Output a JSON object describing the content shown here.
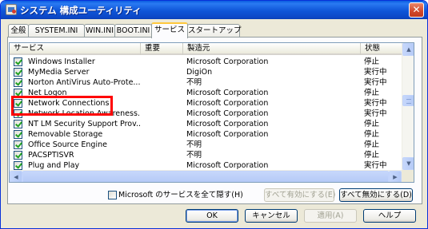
{
  "window": {
    "title": "システム 構成ユーティリティ",
    "close_label": "✕"
  },
  "tabs": [
    {
      "label": "全般"
    },
    {
      "label": "SYSTEM.INI"
    },
    {
      "label": "WIN.INI"
    },
    {
      "label": "BOOT.INI"
    },
    {
      "label": "サービス"
    },
    {
      "label": "スタートアップ"
    }
  ],
  "active_tab": "サービス",
  "columns": {
    "service": "サービス",
    "essential": "重要",
    "manufacturer": "製造元",
    "status": "状態"
  },
  "services": [
    {
      "name": "Windows Installer",
      "essential": "",
      "manufacturer": "Microsoft Corporation",
      "status": "停止",
      "checked": true
    },
    {
      "name": "MyMedia Server",
      "essential": "",
      "manufacturer": "DigiOn",
      "status": "実行中",
      "checked": true
    },
    {
      "name": "Norton AntiVirus Auto-Prote...",
      "essential": "",
      "manufacturer": "不明",
      "status": "実行中",
      "checked": true
    },
    {
      "name": "Net Logon",
      "essential": "",
      "manufacturer": "Microsoft Corporation",
      "status": "停止",
      "checked": true
    },
    {
      "name": "Network Connections",
      "essential": "",
      "manufacturer": "Microsoft Corporation",
      "status": "実行中",
      "checked": true
    },
    {
      "name": "Network Location Awareness...",
      "essential": "",
      "manufacturer": "Microsoft Corporation",
      "status": "実行中",
      "checked": true
    },
    {
      "name": "NT LM Security Support Prov...",
      "essential": "",
      "manufacturer": "Microsoft Corporation",
      "status": "停止",
      "checked": true
    },
    {
      "name": "Removable Storage",
      "essential": "",
      "manufacturer": "Microsoft Corporation",
      "status": "停止",
      "checked": true
    },
    {
      "name": "Office Source Engine",
      "essential": "",
      "manufacturer": "不明",
      "status": "停止",
      "checked": true
    },
    {
      "name": "PACSPTISVR",
      "essential": "",
      "manufacturer": "不明",
      "status": "停止",
      "checked": true
    },
    {
      "name": "Plug and Play",
      "essential": "",
      "manufacturer": "Microsoft Corporation",
      "status": "実行中",
      "checked": true
    }
  ],
  "highlighted_service": "Network Connections",
  "highlight_color": "#ff0000",
  "scroll": {
    "up_icon": "▲",
    "down_icon": "▼",
    "left_icon": "◀",
    "right_icon": "▶"
  },
  "hide_microsoft_label": "Microsoft のサービスを全て隠す(H)",
  "hide_microsoft_checked": false,
  "buttons": {
    "enable_all": "すべて有効にする(E)",
    "disable_all": "すべて無効にする(D)",
    "ok": "OK",
    "cancel": "キャンセル",
    "apply": "適用(A)",
    "help": "ヘルプ"
  }
}
